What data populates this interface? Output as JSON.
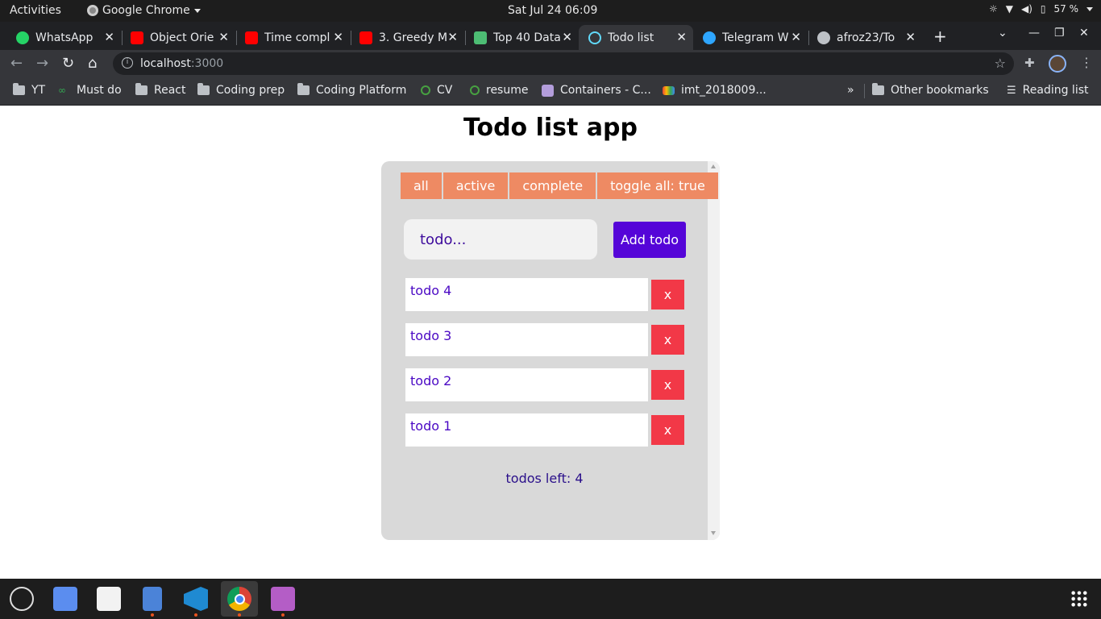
{
  "system": {
    "activities": "Activities",
    "app_name": "Google Chrome",
    "clock": "Sat Jul 24  06:09",
    "battery": "57 %"
  },
  "browser": {
    "tabs": [
      {
        "title": "WhatsApp",
        "favicon_color": "#25d366"
      },
      {
        "title": "Object Orie",
        "favicon_color": "#ff0000"
      },
      {
        "title": "Time compl",
        "favicon_color": "#ff0000"
      },
      {
        "title": "3. Greedy M",
        "favicon_color": "#ff0000"
      },
      {
        "title": "Top 40 Data",
        "favicon_color": "#4dbd74"
      },
      {
        "title": "Todo list",
        "favicon_color": "#61dafb"
      },
      {
        "title": "Telegram W",
        "favicon_color": "#2ea6ff"
      },
      {
        "title": "afroz23/To",
        "favicon_color": "#bdc1c6"
      }
    ],
    "active_tab": "Todo list",
    "url_host": "localhost",
    "url_port": ":3000",
    "bookmarks": [
      {
        "label": "YT",
        "icon": "folder-icon"
      },
      {
        "label": "Must do",
        "icon": "link-icon"
      },
      {
        "label": "React",
        "icon": "folder-icon"
      },
      {
        "label": "Coding prep",
        "icon": "folder-icon"
      },
      {
        "label": "Coding Platform",
        "icon": "folder-icon"
      },
      {
        "label": "CV",
        "icon": "overleaf-icon"
      },
      {
        "label": "resume",
        "icon": "overleaf-icon"
      },
      {
        "label": "Containers - C...",
        "icon": "site-icon"
      },
      {
        "label": "imt_2018009...",
        "icon": "gmail-icon"
      }
    ],
    "overflow_glyph": "»",
    "other_bookmarks": "Other bookmarks",
    "reading_list": "Reading list"
  },
  "app": {
    "title": "Todo list app",
    "filters": [
      "all",
      "active",
      "complete",
      "toggle all: true"
    ],
    "input_placeholder": "todo...",
    "add_label": "Add todo",
    "todos": [
      {
        "text": "todo 4",
        "delete_label": "x"
      },
      {
        "text": "todo 3",
        "delete_label": "x"
      },
      {
        "text": "todo 2",
        "delete_label": "x"
      },
      {
        "text": "todo 1",
        "delete_label": "x"
      }
    ],
    "todos_left": "todos left: 4"
  },
  "colors": {
    "filter_button": "#ee8a63",
    "add_button": "#5505d8",
    "delete_button": "#f23847",
    "panel": "#d9d9d9"
  },
  "dock": [
    "ubuntu-software-icon",
    "tasks-icon",
    "text-editor-icon",
    "files-icon",
    "vscode-icon",
    "chrome-icon",
    "media-player-icon"
  ]
}
